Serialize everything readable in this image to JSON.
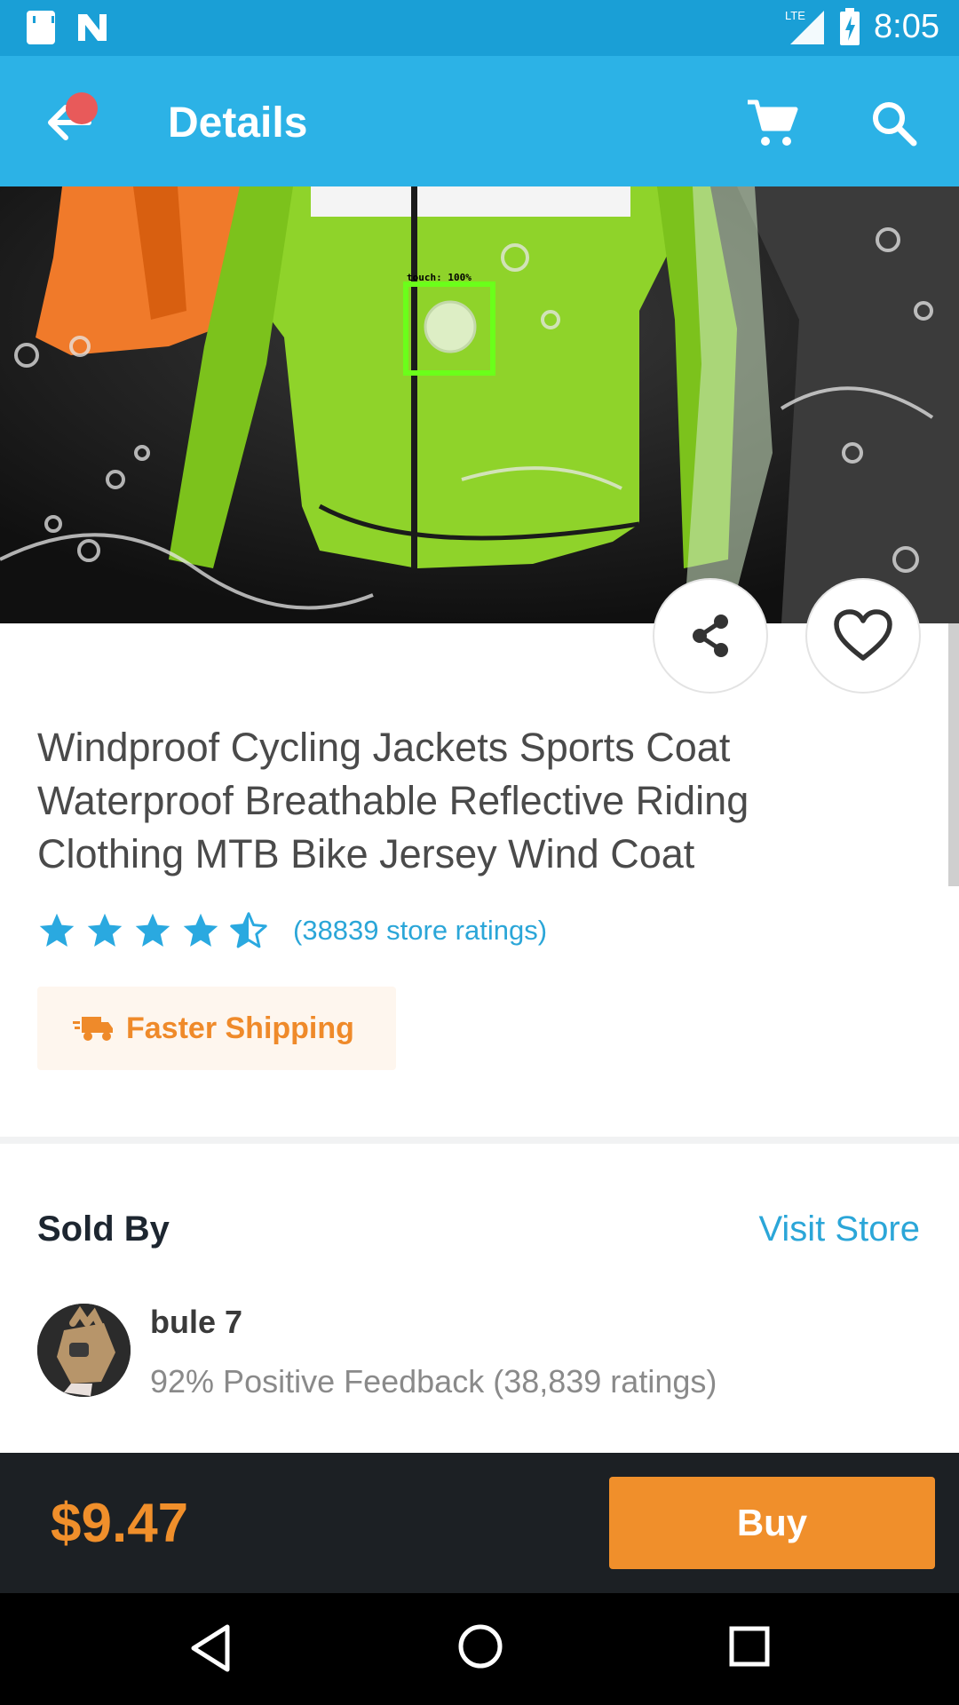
{
  "status_bar": {
    "time": "8:05",
    "network": "LTE",
    "icons": [
      "sd-card-icon",
      "n-icon",
      "lte-signal-icon",
      "battery-charging-icon"
    ]
  },
  "app_bar": {
    "title": "Details",
    "icons": [
      "back-arrow-icon",
      "cart-icon",
      "search-icon"
    ],
    "accent_color": "#2cb2e6"
  },
  "hero": {
    "overlay_label": "touch: 100%"
  },
  "product": {
    "title": "Windproof Cycling Jackets Sports Coat Waterproof Breathable Reflective Riding Clothing MTB Bike Jersey Wind Coat",
    "rating": 4.5,
    "rating_max": 5,
    "ratings_text": "(38839 store ratings)",
    "shipping_badge": "Faster Shipping"
  },
  "seller": {
    "section_title": "Sold By",
    "visit_store": "Visit Store",
    "name": "bule 7",
    "feedback": "92% Positive Feedback (38,839 ratings)"
  },
  "buy_bar": {
    "price": "$9.47",
    "buy_label": "Buy",
    "price_color": "#f08f2b"
  },
  "nav_bar": {
    "icons": [
      "nav-back-icon",
      "nav-home-icon",
      "nav-recents-icon"
    ]
  }
}
